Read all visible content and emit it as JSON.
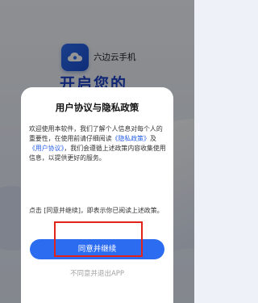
{
  "background": {
    "app_name": "六边云手机",
    "slogan": "开启您的"
  },
  "dialog": {
    "title": "用户协议与隐私政策",
    "body_intro": "欢迎使用本软件，我们了解个人信息对每个人的重要性，在使用前请仔细阅读",
    "privacy_link": "《隐私政策》",
    "and_text": "及",
    "user_agreement_link": "《用户协议》",
    "body_rest": "，我们会遵循上述政策内容收集使用信息，以提供更好的服务。",
    "note": "点击 [同意并继续]，即表示你已阅读上述政策。",
    "agree_label": "同意并继续",
    "disagree_label": "不同意并退出APP"
  },
  "colors": {
    "accent": "#2c6cf0",
    "link": "#2a62e8",
    "highlight": "#e2231a"
  }
}
